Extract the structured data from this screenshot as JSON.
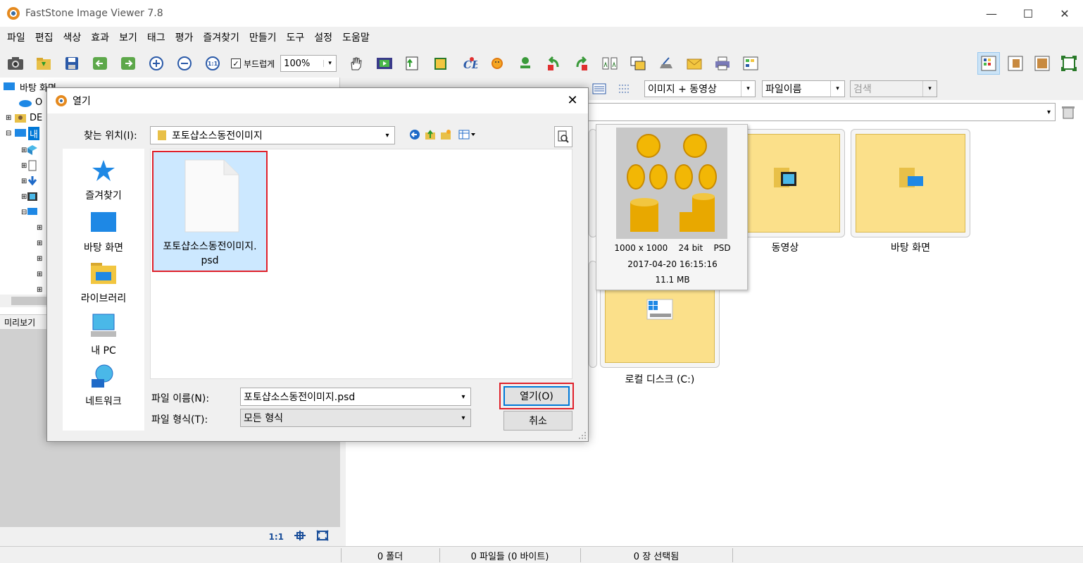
{
  "window": {
    "title": "FastStone Image Viewer 7.8",
    "minimize": "—",
    "maximize": "☐",
    "close": "✕"
  },
  "menu": [
    "파일",
    "편집",
    "색상",
    "효과",
    "보기",
    "태그",
    "평가",
    "즐겨찾기",
    "만들기",
    "도구",
    "설정",
    "도움말"
  ],
  "toolbar": {
    "smooth_label": "부드럽게",
    "smooth_checked": "✓",
    "zoom_value": "100%",
    "dropdown_arrow": "▾"
  },
  "tree": {
    "desktop": "바탕 화면",
    "onedrive_partial": "O",
    "user_partial": "DE",
    "mypc_partial": "내"
  },
  "preview": {
    "label": "미리보기",
    "zoom_1to1": "1:1"
  },
  "browser": {
    "filter_value": "이미지 + 동영상",
    "sort_value": "파일이름",
    "search_placeholder": "검색",
    "items": [
      {
        "label": "동영상"
      },
      {
        "label": "바탕 화면"
      },
      {
        "label": "로컬 디스크 (C:)"
      }
    ]
  },
  "tooltip": {
    "dims": "1000 x 1000",
    "bits": "24 bit",
    "format": "PSD",
    "date": "2017-04-20 16:15:16",
    "size": "11.1 MB"
  },
  "status": {
    "folders": "0 폴더",
    "files": "0 파일들 (0 바이트)",
    "selected": "0 장 선택됨"
  },
  "dialog": {
    "title": "열기",
    "close": "✕",
    "lookin_label": "찾는 위치(I):",
    "lookin_value": "포토샵소스동전이미지",
    "places": [
      "즐겨찾기",
      "바탕 화면",
      "라이브러리",
      "내 PC",
      "네트워크"
    ],
    "file": {
      "name_line1": "포토샵소스동전이미지.",
      "name_line2": "psd"
    },
    "filename_label": "파일 이름(N):",
    "filename_value": "포토샵소스동전이미지.psd",
    "filetype_label": "파일 형식(T):",
    "filetype_value": "모든 형식",
    "open_button": "열기(O)",
    "cancel_button": "취소"
  },
  "colors": {
    "accent": "#0078d7",
    "highlight": "#e0202a",
    "folder": "#fbe08a",
    "selection": "#cce8ff"
  }
}
